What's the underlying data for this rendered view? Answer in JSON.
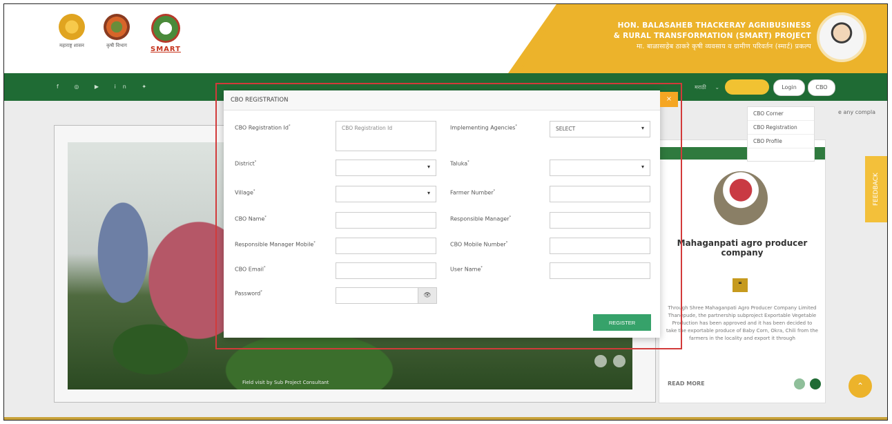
{
  "header": {
    "logo1_caption": "महाराष्ट्र शासन",
    "logo2_caption": "कृषी विभाग",
    "logo3_caption": "SMART",
    "banner_line1": "HON. BALASAHEB THACKERAY AGRIBUSINESS",
    "banner_line2": "& RURAL TRANSFORMATION (SMART) PROJECT",
    "banner_line3": "मा. बाळासाहेब ठाकरे कृषी व्यवसाय व ग्रामीण परिवर्तन (स्मार्ट) प्रकल्प"
  },
  "nav": {
    "social_icons": "f ◎ ▶ in ✦",
    "lang": "मराठी",
    "yellow_pill": "",
    "login": "Login",
    "cbo": "CBO"
  },
  "dropdown": {
    "items": [
      "CBO Corner",
      "CBO Registration",
      "CBO Profile"
    ]
  },
  "truncated_text": "e any compla",
  "feedback_tab": "FEEDBACK",
  "slider": {
    "caption": "Field visit by Sub Project Consultant"
  },
  "card": {
    "title": "Mahaganpati agro producer company",
    "quote_mark": "❝",
    "description": "Through Shree Mahaganpati Agro Producer Company Limited Thanepude, the partnership subproject Exportable Vegetable Production has been approved and it has been decided to take the exportable produce of Baby Corn, Okra, Chili from the farmers in the locality and export it through",
    "read_more": "READ MORE"
  },
  "modal": {
    "title": "CBO REGISTRATION",
    "close": "×",
    "fields": {
      "cbo_reg_id_label": "CBO Registration Id",
      "cbo_reg_id_placeholder": "CBO Registration Id",
      "impl_agencies_label": "Implementing Agencies",
      "impl_agencies_value": "SELECT",
      "district_label": "District",
      "taluka_label": "Taluka",
      "village_label": "Village",
      "farmer_number_label": "Farmer Number",
      "cbo_name_label": "CBO Name",
      "resp_manager_label": "Responsible Manager",
      "resp_manager_mobile_label": "Responsible Manager Mobile",
      "cbo_mobile_label": "CBO Mobile Number",
      "cbo_email_label": "CBO Email",
      "user_name_label": "User Name",
      "password_label": "Password"
    },
    "register_button": "REGISTER"
  },
  "colors": {
    "nav_green": "#1f6b34",
    "banner_gold": "#ecb32b",
    "register_green": "#36a26a",
    "close_orange": "#f5a623"
  }
}
